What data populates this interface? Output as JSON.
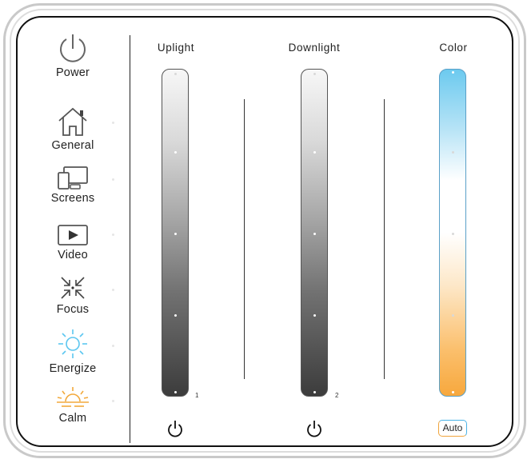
{
  "modes": [
    {
      "id": "power",
      "label": "Power",
      "icon": "power-icon"
    },
    {
      "id": "general",
      "label": "General",
      "icon": "house-icon"
    },
    {
      "id": "screens",
      "label": "Screens",
      "icon": "screens-icon"
    },
    {
      "id": "video",
      "label": "Video",
      "icon": "play-icon"
    },
    {
      "id": "focus",
      "label": "Focus",
      "icon": "focus-arrows-icon"
    },
    {
      "id": "energize",
      "label": "Energize",
      "icon": "sun-icon"
    },
    {
      "id": "calm",
      "label": "Calm",
      "icon": "sunset-icon"
    }
  ],
  "columns": {
    "uplight": {
      "title": "Uplight",
      "number": "1"
    },
    "downlight": {
      "title": "Downlight",
      "number": "2"
    },
    "color": {
      "title": "Color",
      "auto_label": "Auto"
    }
  },
  "colors": {
    "energize": "#5bc6f0",
    "calm": "#f2a93b",
    "auto_blue": "#49b2e6",
    "auto_orange": "#f0a43c"
  }
}
